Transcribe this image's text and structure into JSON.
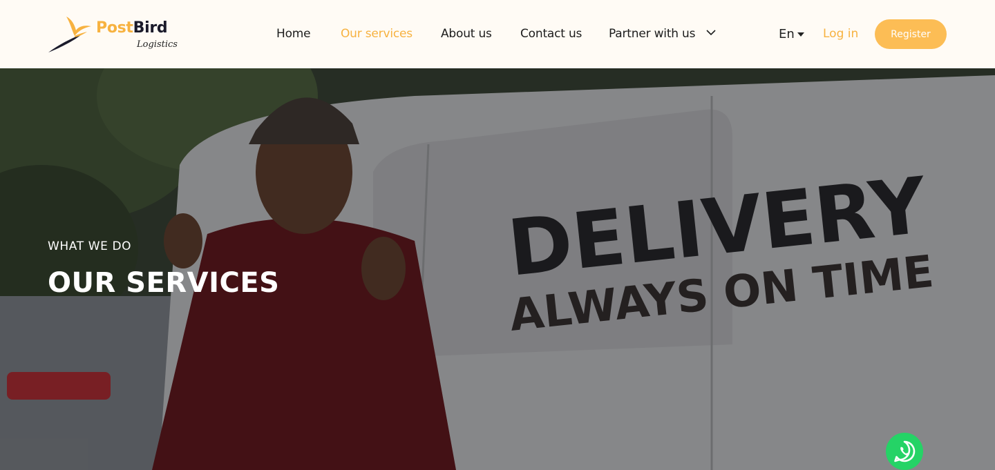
{
  "brand": {
    "name_part1": "Post",
    "name_part2": "Bird",
    "tagline": "Logistics"
  },
  "nav": {
    "items": [
      {
        "label": "Home",
        "active": false
      },
      {
        "label": "Our services",
        "active": true
      },
      {
        "label": "About us",
        "active": false
      },
      {
        "label": "Contact us",
        "active": false
      },
      {
        "label": "Partner with us",
        "active": false,
        "has_dropdown": true
      }
    ]
  },
  "header_actions": {
    "language": "En",
    "login": "Log in",
    "register": "Register"
  },
  "hero": {
    "kicker": "WHAT WE DO",
    "title": "OUR SERVICES",
    "van_text_1": "DELIVERY",
    "van_text_2": "ALWAYS ON TIME"
  },
  "floating": {
    "icon": "whatsapp-icon"
  },
  "colors": {
    "accent": "#f7b240",
    "button": "#fcbd55",
    "whatsapp": "#25d366",
    "header_bg": "#fffbf5"
  }
}
